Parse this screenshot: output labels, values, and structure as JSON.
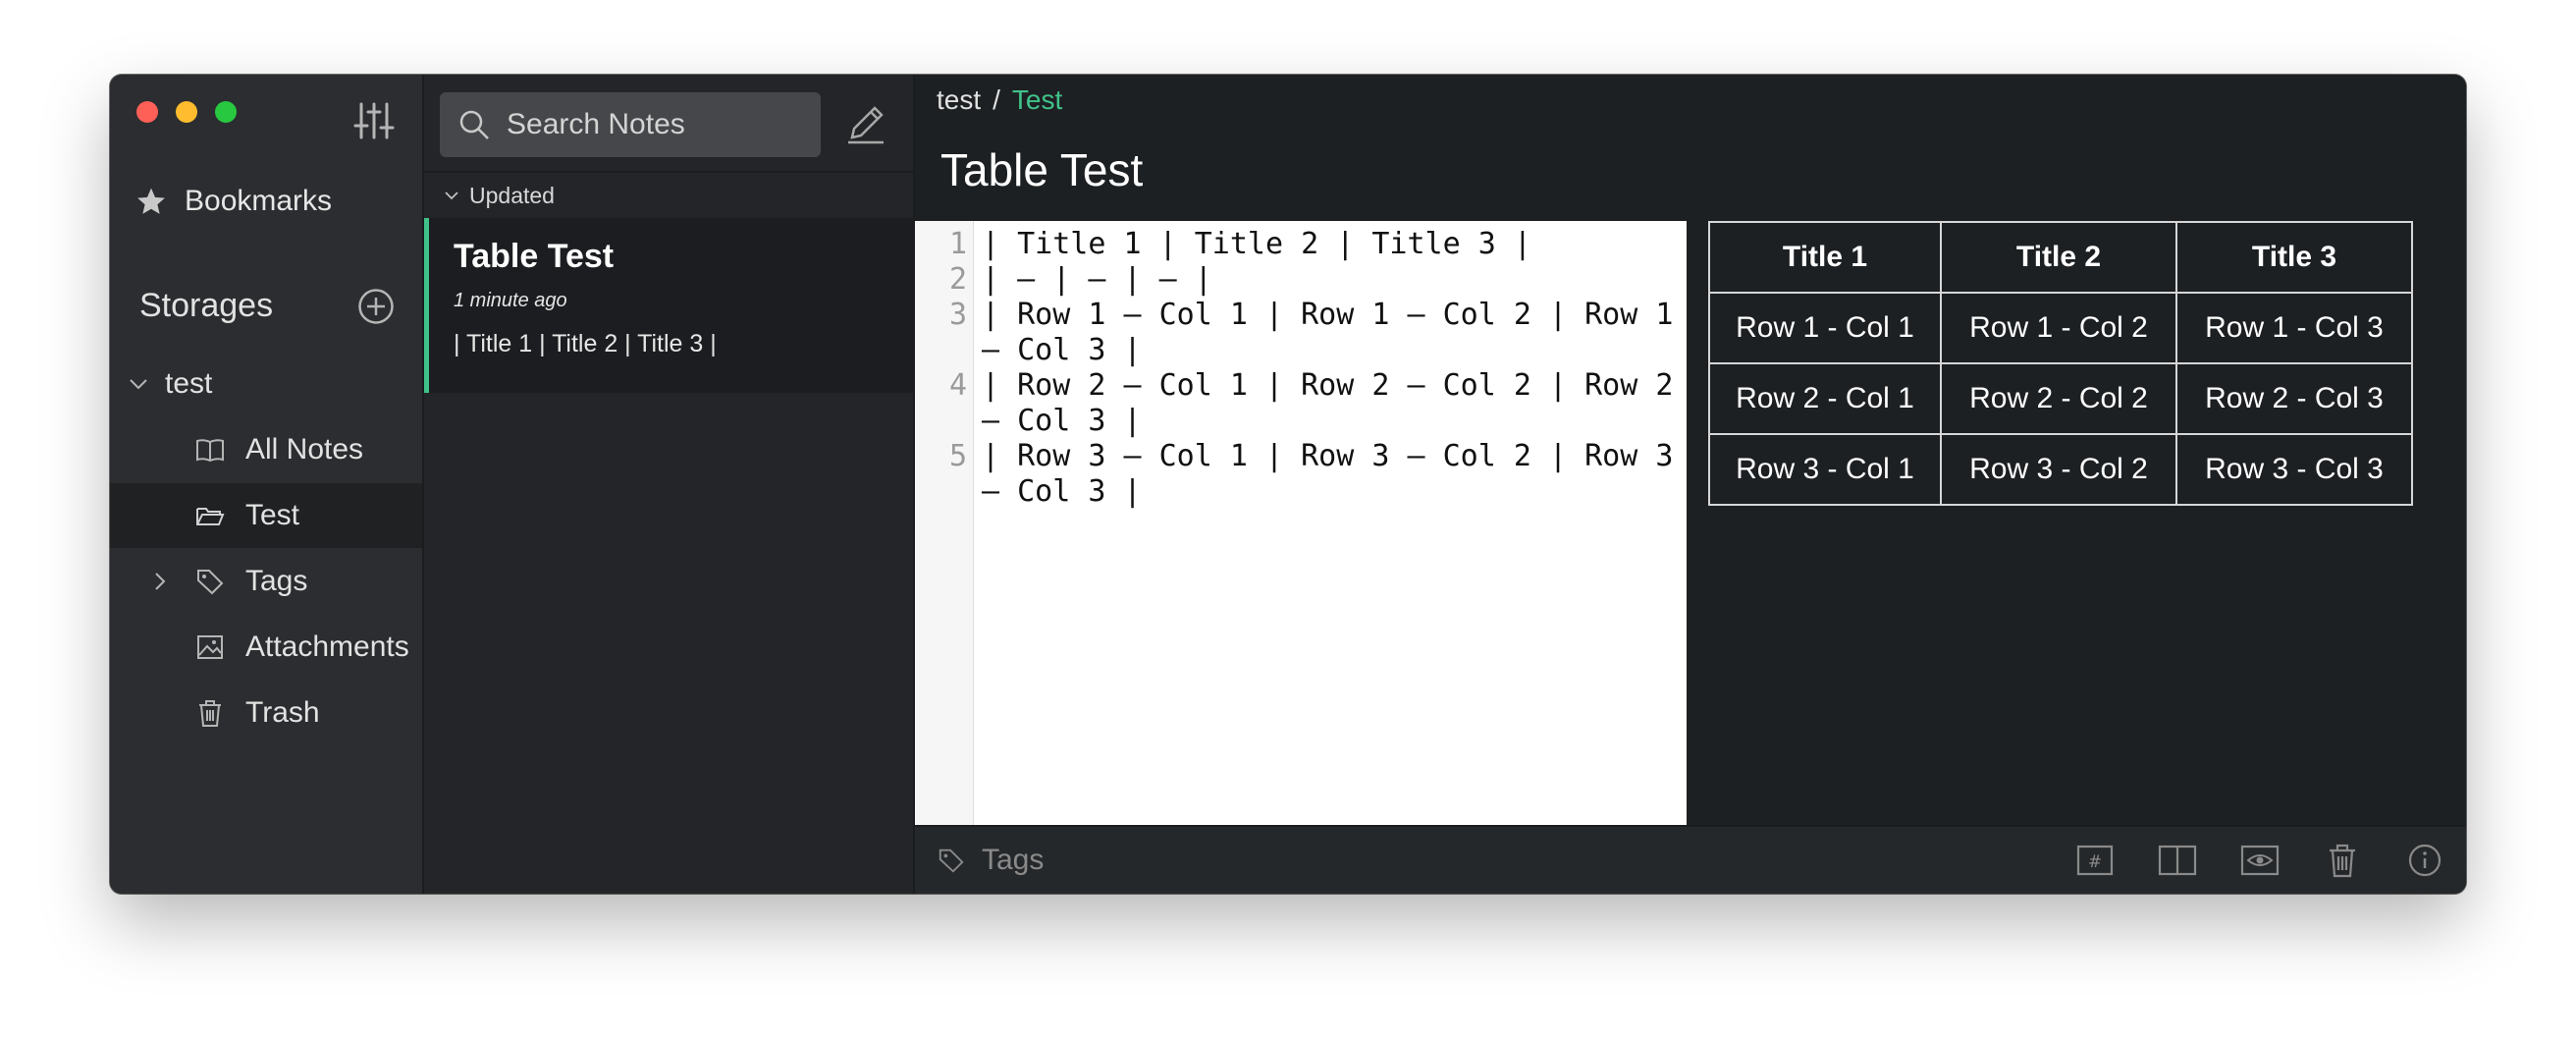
{
  "sidebar": {
    "bookmarks_label": "Bookmarks",
    "storages_title": "Storages",
    "storage_name": "test",
    "items": [
      {
        "label": "All Notes"
      },
      {
        "label": "Test"
      },
      {
        "label": "Tags"
      },
      {
        "label": "Attachments"
      },
      {
        "label": "Trash"
      }
    ]
  },
  "notelist": {
    "search_placeholder": "Search Notes",
    "sort_label": "Updated",
    "notes": [
      {
        "title": "Table Test",
        "time": "1 minute ago",
        "preview": "| Title 1 | Title 2 | Title 3 |"
      }
    ]
  },
  "detail": {
    "breadcrumb": {
      "storage": "test",
      "separator": "/",
      "folder": "Test"
    },
    "title": "Table Test",
    "editor_lines": [
      {
        "num": "1",
        "text": "| Title 1 | Title 2 | Title 3 |"
      },
      {
        "num": "2",
        "text": "| – | – | – |"
      },
      {
        "num": "3",
        "text": "| Row 1 – Col 1 | Row 1 – Col 2 | Row 1 – Col 3 |"
      },
      {
        "num": "4",
        "text": "| Row 2 – Col 1 | Row 2 – Col 2 | Row 2 – Col 3 |"
      },
      {
        "num": "5",
        "text": "| Row 3 – Col 1 | Row 3 – Col 2 | Row 3 – Col 3 |"
      }
    ],
    "table": {
      "headers": [
        "Title 1",
        "Title 2",
        "Title 3"
      ],
      "rows": [
        [
          "Row 1 - Col 1",
          "Row 1 - Col 2",
          "Row 1 - Col 3"
        ],
        [
          "Row 2 - Col 1",
          "Row 2 - Col 2",
          "Row 2 - Col 3"
        ],
        [
          "Row 3 - Col 1",
          "Row 3 - Col 2",
          "Row 3 - Col 3"
        ]
      ]
    },
    "tags_placeholder": "Tags"
  },
  "colors": {
    "accent": "#41c28a",
    "window_bg": "#1d2023",
    "sidebar_bg": "#2b2d30"
  },
  "icons": [
    "sliders-icon",
    "star-icon",
    "plus-circle-icon",
    "chevron-down-icon",
    "book-icon",
    "folder-open-icon",
    "chevron-right-icon",
    "tag-icon",
    "image-icon",
    "trash-icon",
    "search-icon",
    "pencil-icon",
    "hashtag-icon",
    "split-view-icon",
    "eye-icon",
    "info-icon"
  ]
}
